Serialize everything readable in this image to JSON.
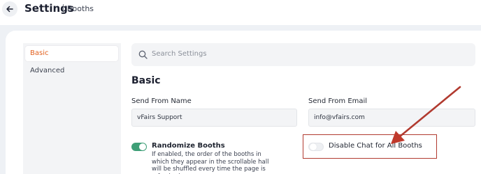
{
  "header": {
    "title": "Settings",
    "breadcrumb": "Booths"
  },
  "sidebar": {
    "items": [
      {
        "label": "Basic",
        "active": true
      },
      {
        "label": "Advanced",
        "active": false
      }
    ]
  },
  "search": {
    "placeholder": "Search Settings"
  },
  "section": {
    "title": "Basic"
  },
  "fields": {
    "send_from_name": {
      "label": "Send From Name",
      "value": "vFairs Support"
    },
    "send_from_email": {
      "label": "Send From Email",
      "value": "info@vfairs.com"
    }
  },
  "options": {
    "randomize_booths": {
      "label": "Randomize Booths",
      "enabled": true,
      "description": "If enabled, the order of the booths in which they appear in the scrollable hall will be shuffled every time the page is refreshed"
    },
    "disable_chat": {
      "label": "Disable Chat for All Booths",
      "enabled": false
    }
  },
  "colors": {
    "accent": "#e2611f",
    "toggle_on": "#3e9f77",
    "annotation": "#b13a2f"
  }
}
